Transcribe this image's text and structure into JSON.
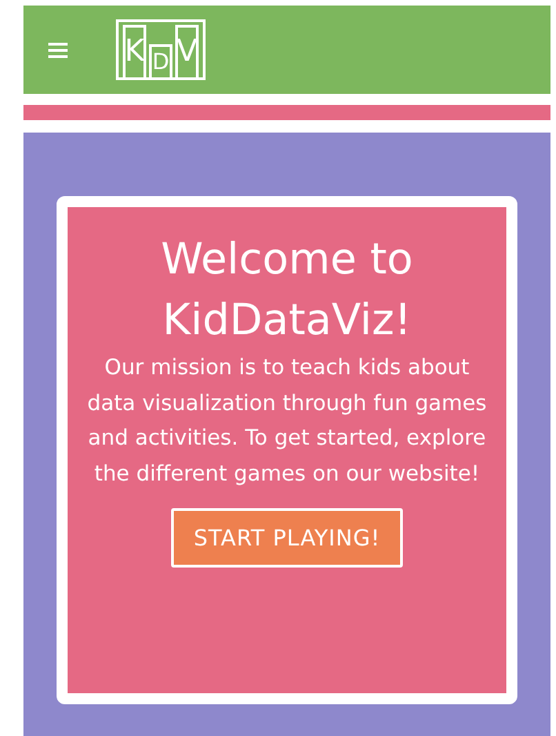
{
  "header": {
    "logo_letters": [
      "K",
      "D",
      "V"
    ]
  },
  "hero": {
    "title": "Welcome to KidDataViz!",
    "text": "Our mission is to teach kids about data visualization through fun games and activities. To get started, explore the different games on our website!",
    "button": "START PLAYING!"
  }
}
